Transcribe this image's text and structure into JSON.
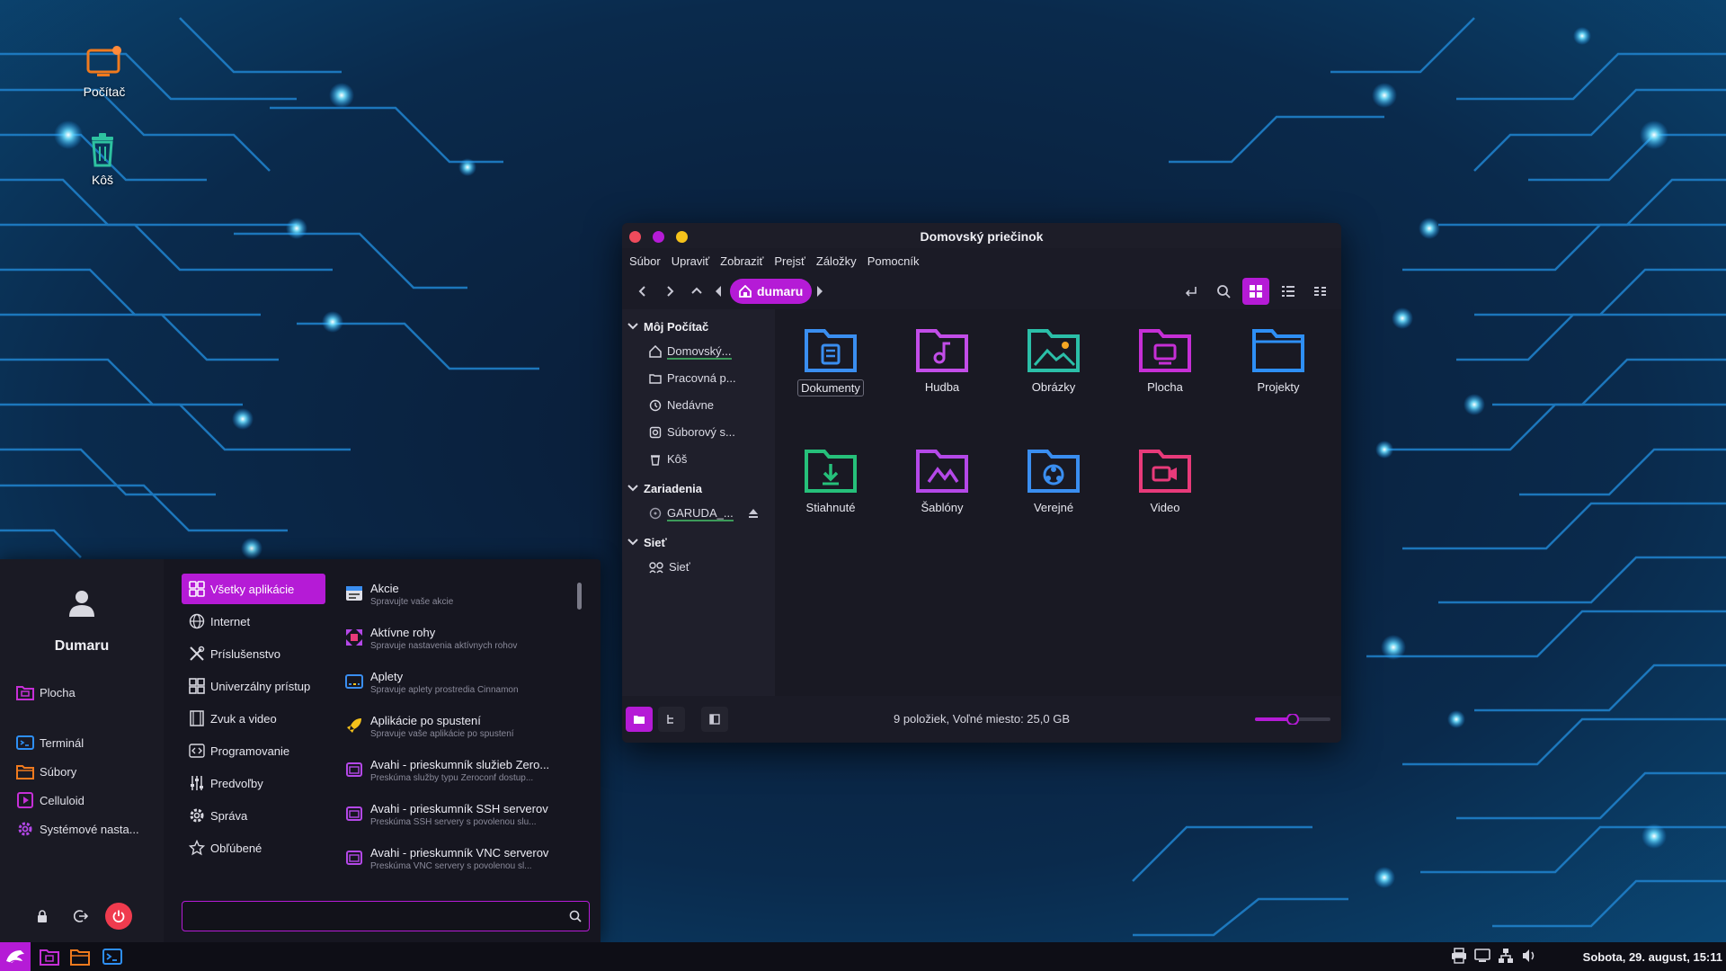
{
  "desktop": {
    "icons": [
      {
        "label": "Počítač"
      },
      {
        "label": "Kôš"
      }
    ]
  },
  "file_manager": {
    "title": "Domovský priečinok",
    "menu": [
      "Súbor",
      "Upraviť",
      "Zobraziť",
      "Prejsť",
      "Záložky",
      "Pomocník"
    ],
    "breadcrumb": "dumaru",
    "sidebar": {
      "section_computer": "Môj Počítač",
      "computer_items": [
        "Domovský...",
        "Pracovná p...",
        "Nedávne",
        "Súborový s...",
        "Kôš"
      ],
      "section_devices": "Zariadenia",
      "device_items": [
        "GARUDA_..."
      ],
      "section_network": "Sieť",
      "network_items": [
        "Sieť"
      ]
    },
    "files": [
      {
        "name": "Dokumenty",
        "color": "#3a8ef0"
      },
      {
        "name": "Hudba",
        "color": "#c24de8"
      },
      {
        "name": "Obrázky",
        "color": "#2bbfa8"
      },
      {
        "name": "Plocha",
        "color": "#c62fd6"
      },
      {
        "name": "Projekty",
        "color": "#2e8ff5"
      },
      {
        "name": "Stiahnuté",
        "color": "#26c07a"
      },
      {
        "name": "Šablóny",
        "color": "#b448e8"
      },
      {
        "name": "Verejné",
        "color": "#3a8ef0"
      },
      {
        "name": "Video",
        "color": "#e83a7a"
      }
    ],
    "status": "9 položiek, Voľné miesto: 25,0 GB",
    "zoom_level": 0.5,
    "accent": "#b51bd6"
  },
  "start_menu": {
    "user_name": "Dumaru",
    "favorites": [
      "Plocha",
      "Terminál",
      "Súbory",
      "Celluloid",
      "Systémové nasta..."
    ],
    "categories": [
      "Všetky aplikácie",
      "Internet",
      "Príslušenstvo",
      "Univerzálny prístup",
      "Zvuk a video",
      "Programovanie",
      "Predvoľby",
      "Správa",
      "Obľúbené"
    ],
    "apps": [
      {
        "name": "Akcie",
        "desc": "Spravujte vaše akcie"
      },
      {
        "name": "Aktívne rohy",
        "desc": "Spravuje nastavenia aktívnych rohov"
      },
      {
        "name": "Aplety",
        "desc": "Spravuje aplety prostredia Cinnamon"
      },
      {
        "name": "Aplikácie po spustení",
        "desc": "Spravuje vaše aplikácie po spustení"
      },
      {
        "name": "Avahi - prieskumník služieb Zero...",
        "desc": "Preskúma služby typu Zeroconf dostup..."
      },
      {
        "name": "Avahi - prieskumník SSH serverov",
        "desc": "Preskúma SSH servery s povolenou slu..."
      },
      {
        "name": "Avahi - prieskumník VNC serverov",
        "desc": "Preskúma VNC servery s povolenou sl..."
      }
    ],
    "search_value": ""
  },
  "panel": {
    "clock": "Sobota, 29. august, 15:11"
  }
}
